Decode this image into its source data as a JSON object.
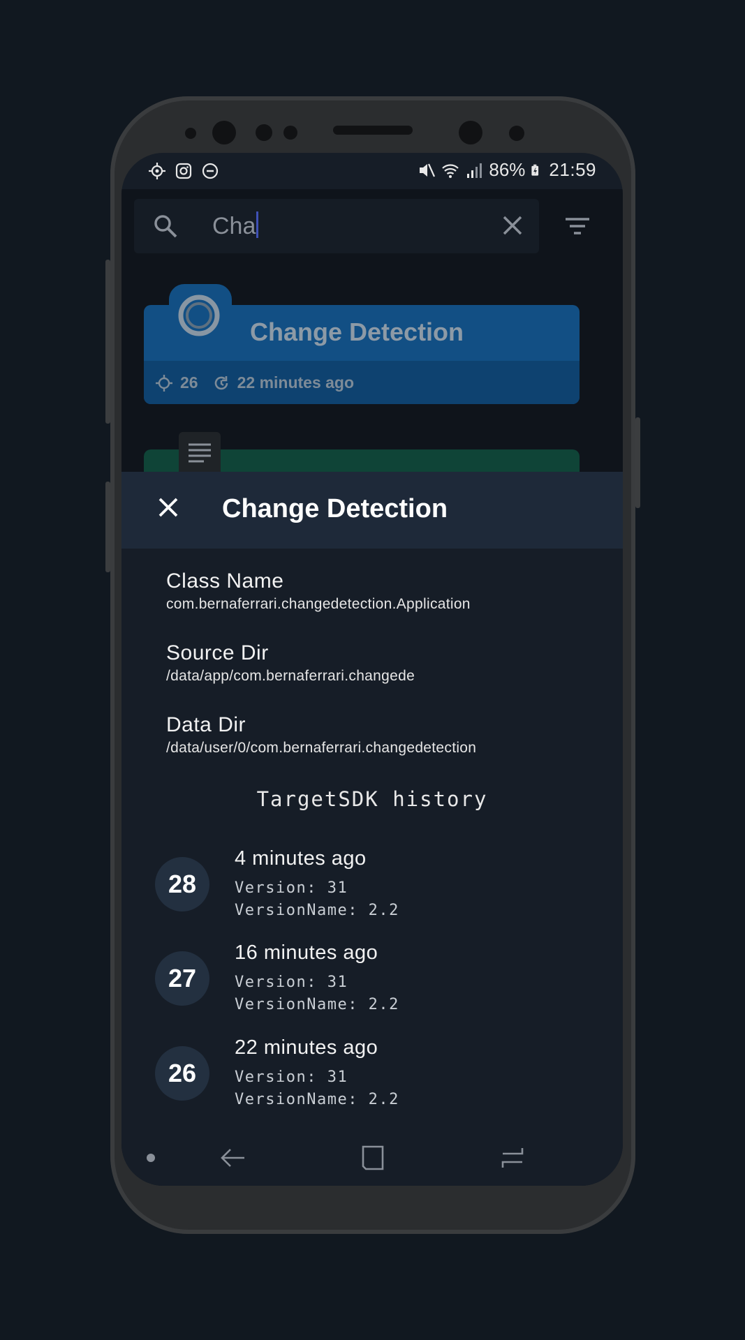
{
  "status_bar": {
    "battery": "86%",
    "time": "21:59",
    "left_icons": [
      "gps-icon",
      "instagram-icon",
      "dnd-icon"
    ],
    "right_icons": [
      "mute-icon",
      "wifi-icon",
      "signal-icon",
      "battery-icon"
    ]
  },
  "search": {
    "query": "Cha"
  },
  "background_list": {
    "card": {
      "title": "Change Detection",
      "count": "26",
      "updated": "22 minutes ago"
    }
  },
  "sheet": {
    "title": "Change Detection",
    "fields": [
      {
        "label": "Class Name",
        "value": "com.bernaferrari.changedetection.Application"
      },
      {
        "label": "Source Dir",
        "value": "/data/app/com.bernaferrari.changede"
      },
      {
        "label": "Data Dir",
        "value": "/data/user/0/com.bernaferrari.changedetection"
      }
    ],
    "history_title": "TargetSDK history",
    "history": [
      {
        "sdk": "28",
        "time": "4 minutes ago",
        "version": "Version: 31",
        "version_name": "VersionName: 2.2"
      },
      {
        "sdk": "27",
        "time": "16 minutes ago",
        "version": "Version: 31",
        "version_name": "VersionName: 2.2"
      },
      {
        "sdk": "26",
        "time": "22 minutes ago",
        "version": "Version: 31",
        "version_name": "VersionName: 2.2"
      }
    ]
  },
  "colors": {
    "accent": "#3f51b5",
    "sheet_header": "#1e2939",
    "card_blue": "#124f84",
    "card_green": "#0f4437"
  }
}
